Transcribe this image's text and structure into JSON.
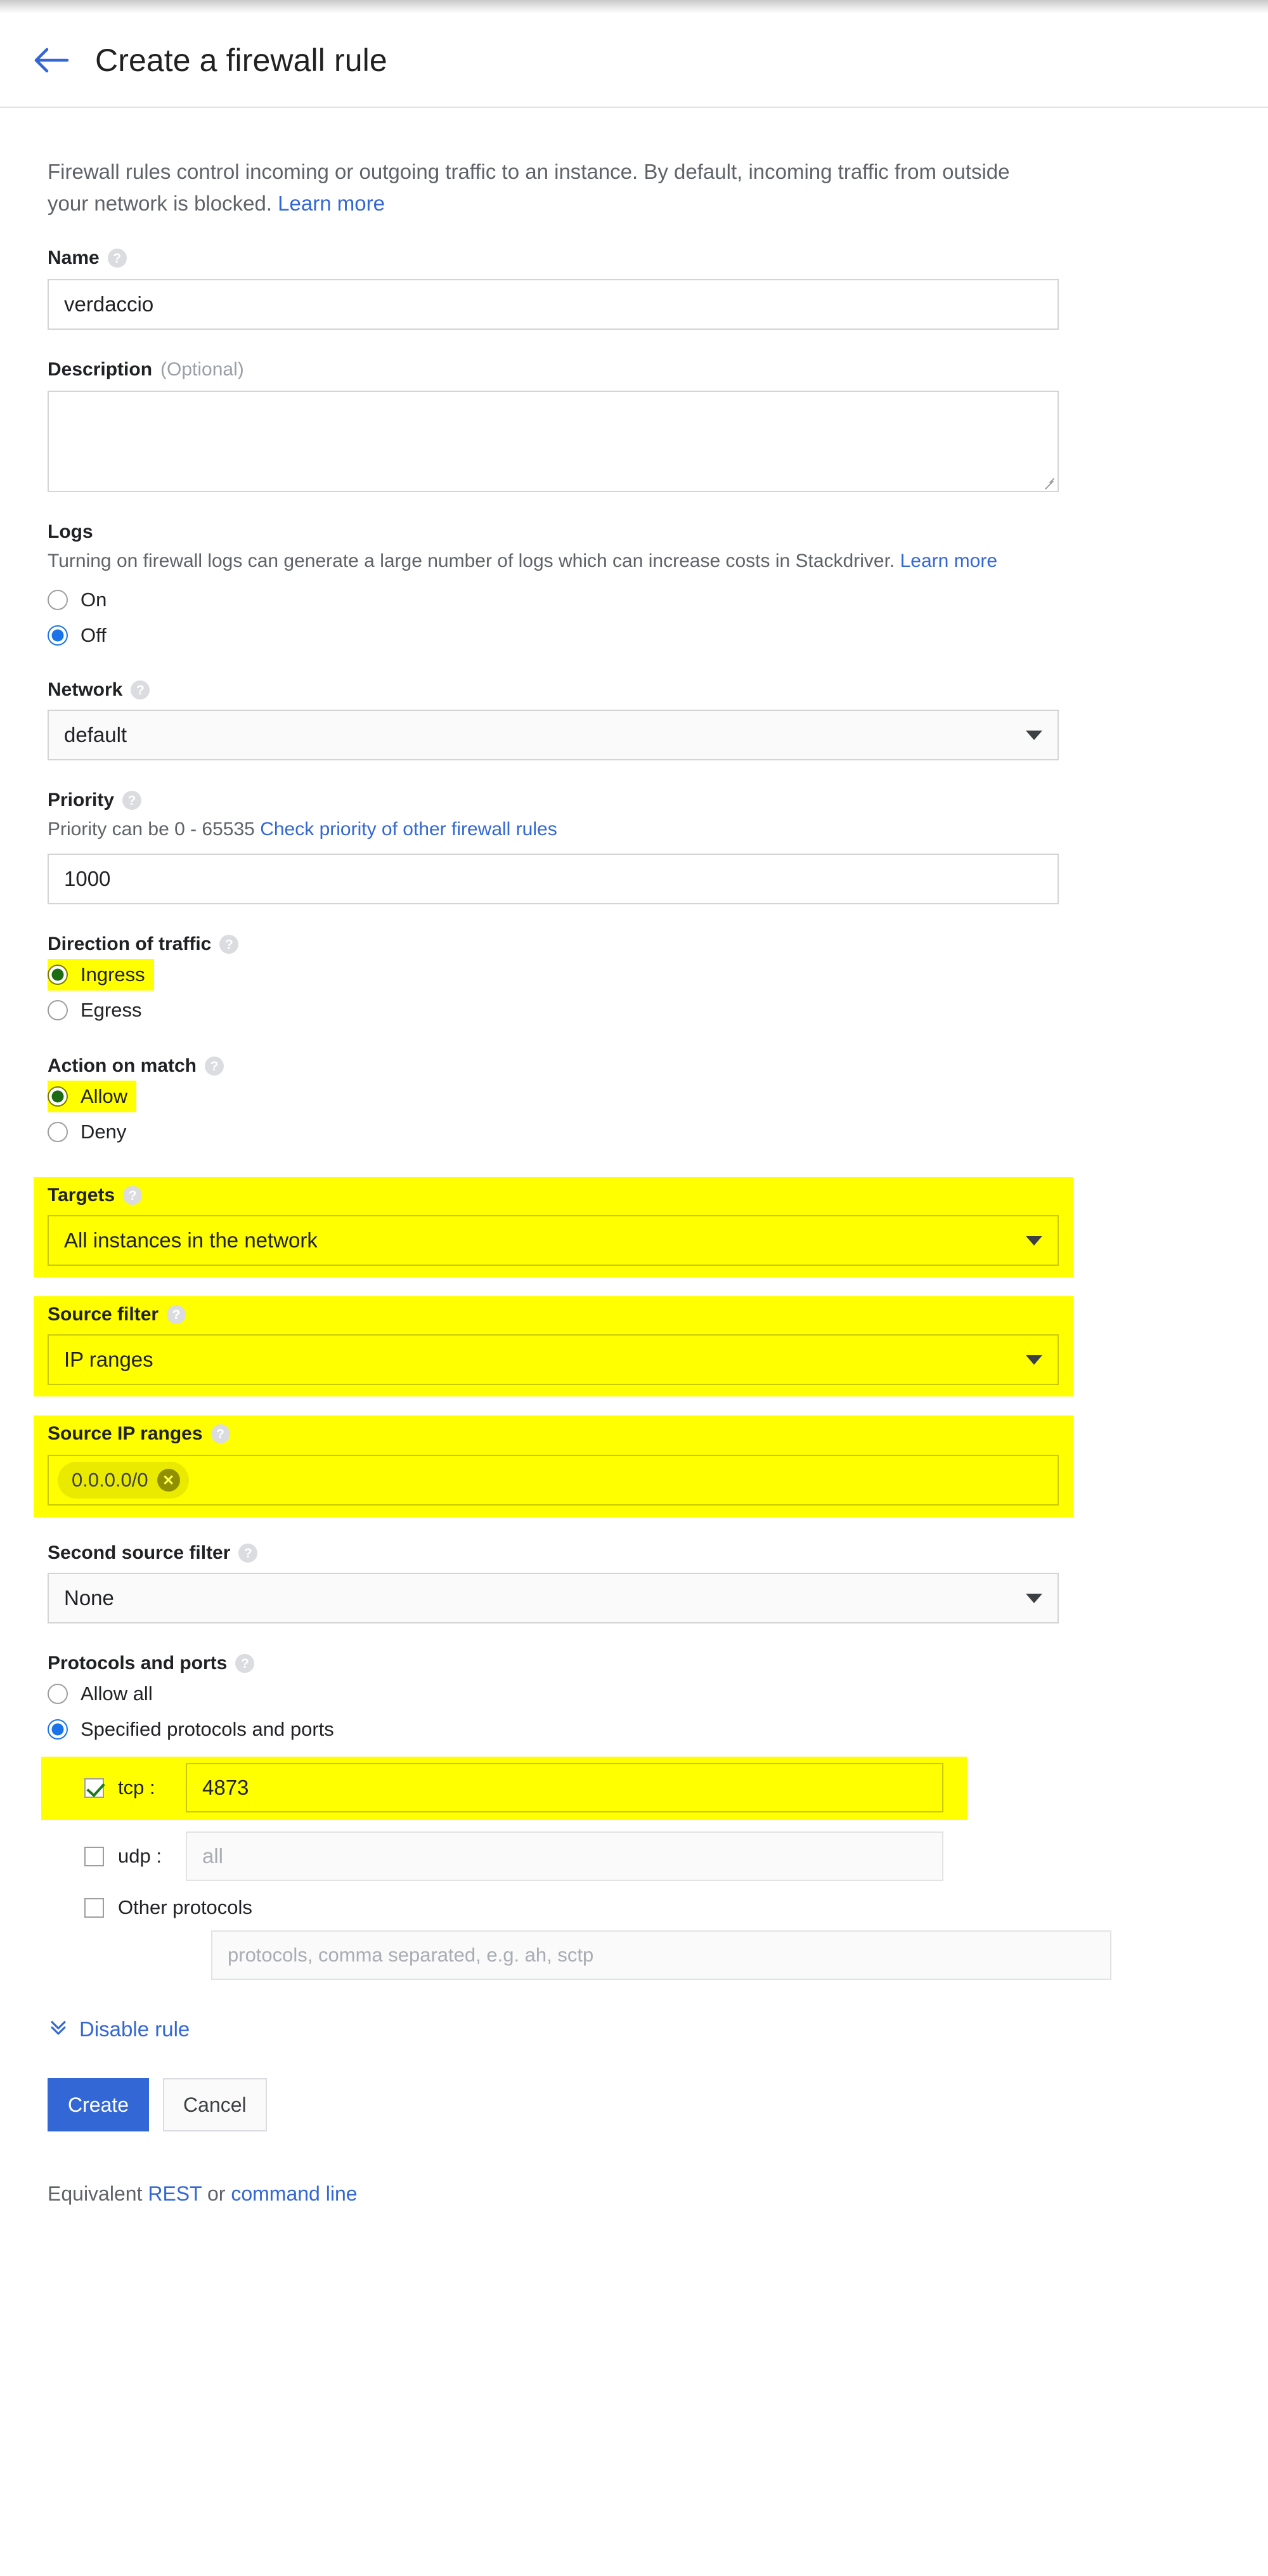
{
  "header": {
    "back_icon": "arrow-left-icon",
    "title": "Create a firewall rule"
  },
  "intro": {
    "text": "Firewall rules control incoming or outgoing traffic to an instance. By default, incoming traffic from outside your network is blocked.",
    "link": "Learn more"
  },
  "name": {
    "label": "Name",
    "help": "?",
    "value": "verdaccio"
  },
  "description": {
    "label": "Description",
    "optional": "(Optional)",
    "value": ""
  },
  "logs": {
    "label": "Logs",
    "subtext": "Turning on firewall logs can generate a large number of logs which can increase costs in Stackdriver.",
    "link": "Learn more",
    "options": [
      "On",
      "Off"
    ],
    "selected": "Off"
  },
  "network": {
    "label": "Network",
    "help": "?",
    "value": "default"
  },
  "priority": {
    "label": "Priority",
    "help": "?",
    "subtext": "Priority can be 0 - 65535",
    "link": "Check priority of other firewall rules",
    "value": "1000"
  },
  "direction": {
    "label": "Direction of traffic",
    "help": "?",
    "options": [
      "Ingress",
      "Egress"
    ],
    "selected": "Ingress",
    "highlighted": "Ingress"
  },
  "action": {
    "label": "Action on match",
    "help": "?",
    "options": [
      "Allow",
      "Deny"
    ],
    "selected": "Allow",
    "highlighted": "Allow"
  },
  "targets": {
    "label": "Targets",
    "help": "?",
    "value": "All instances in the network",
    "highlighted": true
  },
  "source_filter": {
    "label": "Source filter",
    "help": "?",
    "value": "IP ranges",
    "highlighted": true
  },
  "source_ip_ranges": {
    "label": "Source IP ranges",
    "help": "?",
    "chip": "0.0.0.0/0",
    "chip_remove": "✕",
    "highlighted": true
  },
  "second_source_filter": {
    "label": "Second source filter",
    "help": "?",
    "value": "None"
  },
  "protocols": {
    "label": "Protocols and ports",
    "help": "?",
    "options": [
      "Allow all",
      "Specified protocols and ports"
    ],
    "selected": "Specified protocols and ports",
    "tcp": {
      "label": "tcp :",
      "checked": true,
      "value": "4873",
      "highlighted": true
    },
    "udp": {
      "label": "udp :",
      "checked": false,
      "placeholder": "all"
    },
    "other": {
      "label": "Other protocols",
      "checked": false,
      "placeholder": "protocols, comma separated, e.g. ah, sctp"
    }
  },
  "disable_rule": {
    "icon": "double-chevron-down-icon",
    "label": "Disable rule"
  },
  "footer": {
    "create": "Create",
    "cancel": "Cancel",
    "equivalent_prefix": "Equivalent ",
    "equivalent_rest": "REST",
    "equivalent_or": " or ",
    "equivalent_cmd": "command line"
  },
  "colors": {
    "accent": "#3367d6",
    "radio_blue": "#1a73e8",
    "highlight": "#ffff00",
    "muted": "#5f6368"
  }
}
